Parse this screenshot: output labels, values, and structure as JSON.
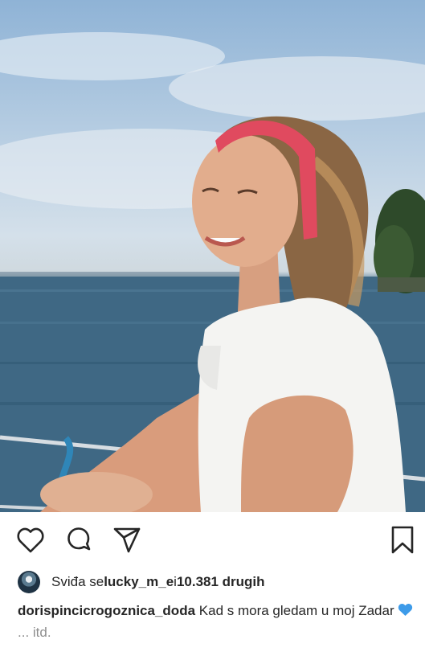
{
  "photo": {
    "subject": "photo-post-image"
  },
  "actions": {
    "like_icon": "heart-outline-icon",
    "comment_icon": "comment-bubble-icon",
    "share_icon": "paper-plane-icon",
    "save_icon": "bookmark-icon"
  },
  "likes": {
    "prefix": "Sviđa se ",
    "user": "lucky_m_e",
    "middle": " i ",
    "count": "10.381 drugih"
  },
  "caption": {
    "username": "dorispincicrogoznica_doda",
    "text": " Kad s mora gledam u moj Zadar ",
    "emoji": "blue-heart-emoji",
    "more": "... itd."
  },
  "colors": {
    "text": "#262626",
    "muted": "#8e8e8e",
    "emoji_blue": "#3d9be9"
  }
}
